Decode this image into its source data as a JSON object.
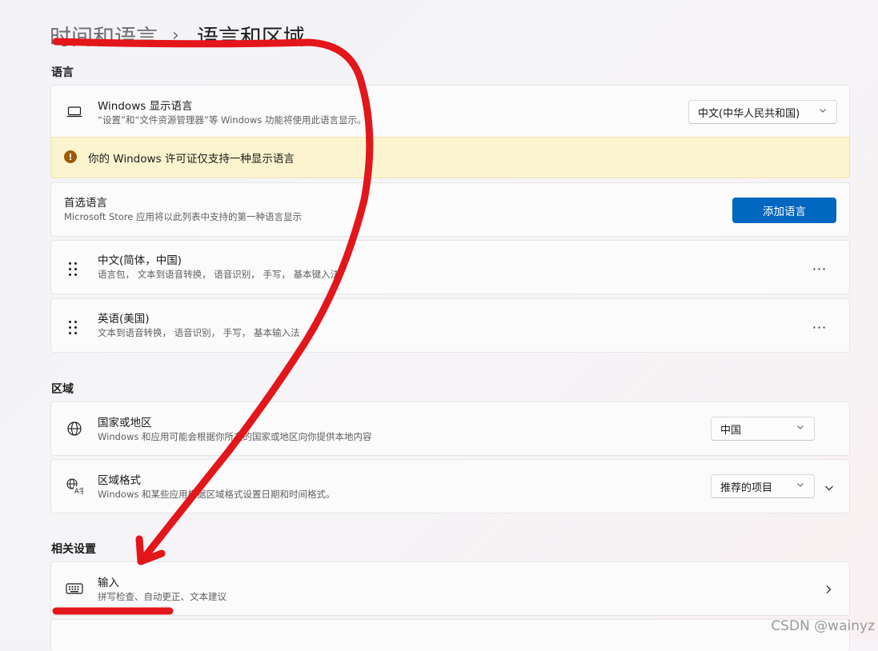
{
  "breadcrumb": {
    "parent": "时间和语言",
    "separator": "›",
    "current": "语言和区域"
  },
  "sections": {
    "language": "语言",
    "region": "区域",
    "related": "相关设置"
  },
  "display_language": {
    "title": "Windows 显示语言",
    "subtitle": "“设置”和“文件资源管理器”等 Windows 功能将使用此语言显示。",
    "icon": "laptop-icon",
    "selected": "中文(中华人民共和国)"
  },
  "license_warning": {
    "icon": "warning-icon",
    "text": "你的 Windows 许可证仅支持一种显示语言"
  },
  "preferred_languages": {
    "title": "首选语言",
    "subtitle": "Microsoft Store 应用将以此列表中支持的第一种语言显示",
    "add_button": "添加语言"
  },
  "languages": [
    {
      "name": "中文(简体，中国)",
      "features": "语言包， 文本到语音转换， 语音识别， 手写， 基本键入法"
    },
    {
      "name": "英语(美国)",
      "features": "文本到语音转换， 语音识别， 手写， 基本输入法"
    }
  ],
  "more_label": "···",
  "country": {
    "title": "国家或地区",
    "subtitle": "Windows 和应用可能会根据你所在的国家或地区向你提供本地内容",
    "icon": "globe-icon",
    "selected": "中国"
  },
  "regional_format": {
    "title": "区域格式",
    "subtitle": "Windows 和某些应用根据区域格式设置日期和时间格式。",
    "icon": "regional-format-icon",
    "selected": "推荐的项目"
  },
  "input": {
    "title": "输入",
    "subtitle": "拼写检查、自动更正、文本建议",
    "icon": "keyboard-icon"
  },
  "watermark": "CSDN @wainyz",
  "colors": {
    "accent": "#0067c0",
    "warning_bg": "#fcf4cf",
    "warning_icon": "#9d5d00",
    "annotation_red": "#e3161b"
  }
}
